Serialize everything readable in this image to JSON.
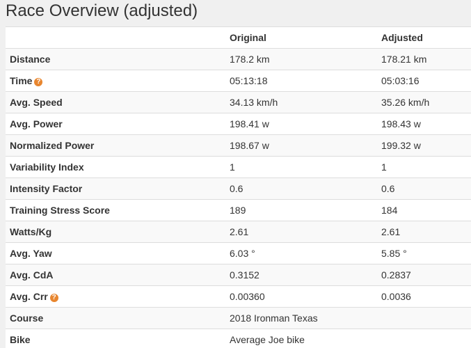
{
  "title": "Race Overview (adjusted)",
  "colors": {
    "help_icon": "#e8862f",
    "row_odd": "#f9f9f9",
    "row_even": "#ffffff",
    "border": "#dddddd",
    "page_background": "#f0f0f0"
  },
  "help_icon": {
    "glyph": "?",
    "icon_name": "question-circle-icon"
  },
  "columns": {
    "label": "",
    "original": "Original",
    "adjusted": "Adjusted"
  },
  "rows": [
    {
      "label": "Distance",
      "original": "178.2 km",
      "adjusted": "178.21 km"
    },
    {
      "label": "Time",
      "original": "05:13:18",
      "adjusted": "05:03:16",
      "has_help": true
    },
    {
      "label": "Avg. Speed",
      "original": "34.13 km/h",
      "adjusted": "35.26 km/h"
    },
    {
      "label": "Avg. Power",
      "original": "198.41 w",
      "adjusted": "198.43 w"
    },
    {
      "label": "Normalized Power",
      "original": "198.67 w",
      "adjusted": "199.32 w"
    },
    {
      "label": "Variability Index",
      "original": "1",
      "adjusted": "1"
    },
    {
      "label": "Intensity Factor",
      "original": "0.6",
      "adjusted": "0.6"
    },
    {
      "label": "Training Stress Score",
      "original": "189",
      "adjusted": "184"
    },
    {
      "label": "Watts/Kg",
      "original": "2.61",
      "adjusted": "2.61"
    },
    {
      "label": "Avg. Yaw",
      "original": "6.03 °",
      "adjusted": "5.85 °"
    },
    {
      "label": "Avg. CdA",
      "original": "0.3152",
      "adjusted": "0.2837"
    },
    {
      "label": "Avg. Crr",
      "original": "0.00360",
      "adjusted": "0.0036",
      "has_help": true
    },
    {
      "label": "Course",
      "original": "2018 Ironman Texas",
      "adjusted": ""
    },
    {
      "label": "Bike",
      "original": "Average Joe bike",
      "adjusted": ""
    }
  ]
}
